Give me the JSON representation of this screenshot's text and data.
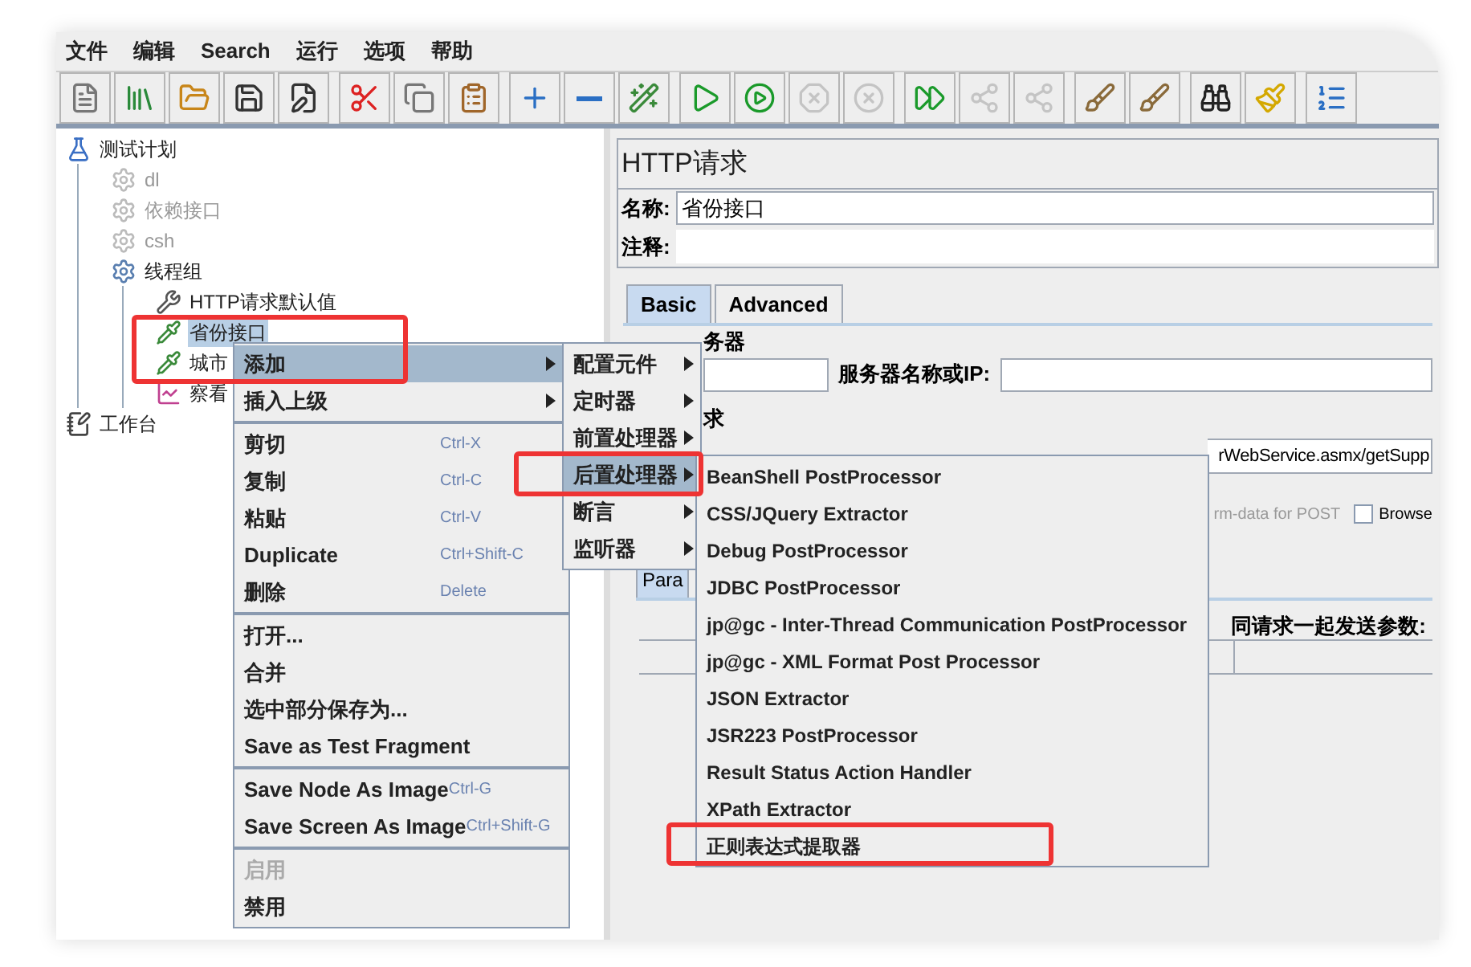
{
  "menu_bar": [
    "文件",
    "编辑",
    "Search",
    "运行",
    "选项",
    "帮助"
  ],
  "toolbar": [
    [
      {
        "disabled": false
      },
      {
        "disabled": false
      },
      {
        "disabled": false
      },
      {
        "disabled": false
      },
      {
        "disabled": false
      }
    ],
    [
      {
        "disabled": false
      },
      {
        "disabled": false
      },
      {
        "disabled": false
      }
    ],
    [
      {
        "disabled": false
      },
      {
        "disabled": false
      },
      {
        "disabled": false
      }
    ],
    [
      {
        "disabled": false
      },
      {
        "disabled": false
      },
      {
        "disabled": true
      },
      {
        "disabled": true
      }
    ],
    [
      {
        "disabled": false
      },
      {
        "disabled": true
      },
      {
        "disabled": true
      }
    ],
    [
      {
        "disabled": false
      },
      {
        "disabled": false
      }
    ],
    [
      {
        "disabled": false
      },
      {
        "disabled": false
      }
    ],
    [
      {
        "disabled": false
      }
    ]
  ],
  "tree": [
    {
      "label": "测试计划",
      "kind": "plan",
      "disabled": false,
      "selected": false,
      "children": [
        {
          "label": "dl",
          "kind": "group",
          "disabled": true,
          "selected": false
        },
        {
          "label": "依赖接口",
          "kind": "group",
          "disabled": true,
          "selected": false
        },
        {
          "label": "csh",
          "kind": "group",
          "disabled": true,
          "selected": false
        },
        {
          "label": "线程组",
          "kind": "group",
          "disabled": false,
          "selected": false,
          "children": [
            {
              "label": "HTTP请求默认值",
              "kind": "config",
              "disabled": false,
              "selected": false
            },
            {
              "label": "省份接口",
              "kind": "sampler",
              "disabled": false,
              "selected": true
            },
            {
              "label": "城市",
              "kind": "sampler",
              "disabled": false,
              "selected": false
            },
            {
              "label": "察看",
              "kind": "listener",
              "disabled": false,
              "selected": false
            }
          ]
        }
      ]
    },
    {
      "label": "工作台",
      "kind": "workbench",
      "disabled": false,
      "selected": false
    }
  ],
  "editor": {
    "title": "HTTP请求",
    "name_label": "名称:",
    "name_value": "省份接口",
    "comment_label": "注释:",
    "tabs": [
      {
        "label": "Basic",
        "selected": true
      },
      {
        "label": "Advanced",
        "selected": false
      }
    ],
    "server_group_label": "务器",
    "server_label": "服务器名称或IP:",
    "request_group_label": "求",
    "path_value": "rWebService.asmx/getSupp",
    "multipart_label": "rm-data for POST",
    "browser_label": "Browse",
    "browser_checked": false,
    "params_tab": "Para",
    "params_label": "同请求一起发送参数:"
  },
  "context_menu": {
    "groups": [
      [
        {
          "label": "添加",
          "submenu": true,
          "selected": true
        },
        {
          "label": "插入上级",
          "submenu": true,
          "selected": false
        }
      ],
      [
        {
          "label": "剪切",
          "shortcut": "Ctrl-X",
          "selected": false
        },
        {
          "label": "复制",
          "shortcut": "Ctrl-C",
          "selected": false
        },
        {
          "label": "粘贴",
          "shortcut": "Ctrl-V",
          "selected": false
        },
        {
          "label": "Duplicate",
          "shortcut": "Ctrl+Shift-C",
          "selected": false
        },
        {
          "label": "删除",
          "shortcut": "Delete",
          "selected": false
        }
      ],
      [
        {
          "label": "打开...",
          "selected": false
        },
        {
          "label": "合并",
          "selected": false
        },
        {
          "label": "选中部分保存为...",
          "selected": false
        },
        {
          "label": "Save as Test Fragment",
          "selected": false
        }
      ],
      [
        {
          "label": "Save Node As Image",
          "shortcut": "Ctrl-G",
          "selected": false
        },
        {
          "label": "Save Screen As Image",
          "shortcut": "Ctrl+Shift-G",
          "selected": false
        }
      ],
      [
        {
          "label": "启用",
          "disabled": true,
          "selected": false
        },
        {
          "label": "禁用",
          "disabled": false,
          "selected": false
        }
      ]
    ]
  },
  "add_submenu": [
    {
      "label": "配置元件",
      "selected": false
    },
    {
      "label": "定时器",
      "selected": false
    },
    {
      "label": "前置处理器",
      "selected": false
    },
    {
      "label": "后置处理器",
      "selected": true
    },
    {
      "label": "断言",
      "selected": false
    },
    {
      "label": "监听器",
      "selected": false
    }
  ],
  "postprocessor_submenu": [
    {
      "label": "BeanShell PostProcessor"
    },
    {
      "label": "CSS/JQuery Extractor"
    },
    {
      "label": "Debug PostProcessor"
    },
    {
      "label": "JDBC PostProcessor"
    },
    {
      "label": "jp@gc - Inter-Thread Communication PostProcessor"
    },
    {
      "label": "jp@gc - XML Format Post Processor"
    },
    {
      "label": "JSON Extractor"
    },
    {
      "label": "JSR223 PostProcessor"
    },
    {
      "label": "Result Status Action Handler"
    },
    {
      "label": "XPath Extractor"
    },
    {
      "label": "正则表达式提取器"
    }
  ]
}
